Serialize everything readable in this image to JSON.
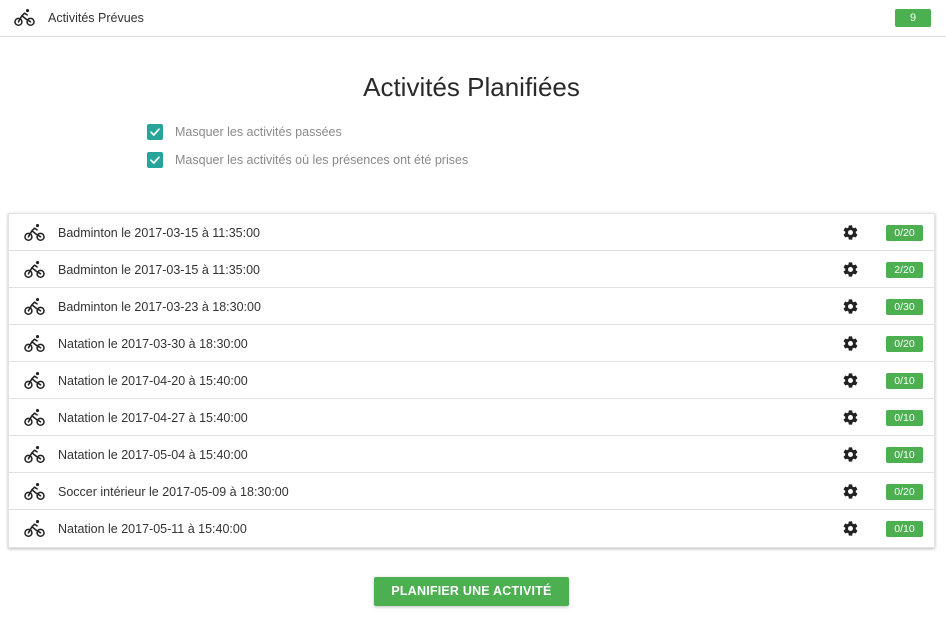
{
  "header": {
    "icon": "bicycle-icon",
    "title": "Activités Prévues",
    "badge": "9"
  },
  "page": {
    "title": "Activités Planifiées"
  },
  "filters": [
    {
      "label": "Masquer les activités passées",
      "checked": true
    },
    {
      "label": "Masquer les activités où les présences ont été prises",
      "checked": true
    }
  ],
  "activities": [
    {
      "icon": "bicycle-icon",
      "label": "Badminton le 2017-03-15 à 11:35:00",
      "count": "0/20"
    },
    {
      "icon": "bicycle-icon",
      "label": "Badminton le 2017-03-15 à 11:35:00",
      "count": "2/20"
    },
    {
      "icon": "bicycle-icon",
      "label": "Badminton le 2017-03-23 à 18:30:00",
      "count": "0/30"
    },
    {
      "icon": "bicycle-icon",
      "label": "Natation le 2017-03-30 à 18:30:00",
      "count": "0/20"
    },
    {
      "icon": "bicycle-icon",
      "label": "Natation le 2017-04-20 à 15:40:00",
      "count": "0/10"
    },
    {
      "icon": "bicycle-icon",
      "label": "Natation le 2017-04-27 à 15:40:00",
      "count": "0/10"
    },
    {
      "icon": "bicycle-icon",
      "label": "Natation le 2017-05-04 à 15:40:00",
      "count": "0/10"
    },
    {
      "icon": "bicycle-icon",
      "label": "Soccer intérieur le 2017-05-09 à 18:30:00",
      "count": "0/20"
    },
    {
      "icon": "bicycle-icon",
      "label": "Natation le 2017-05-11 à 15:40:00",
      "count": "0/10"
    }
  ],
  "actions": {
    "plan_button": "PLANIFIER UNE ACTIVITÉ"
  },
  "colors": {
    "accent_green": "#4caf50",
    "checkbox_teal": "#26a69a"
  }
}
